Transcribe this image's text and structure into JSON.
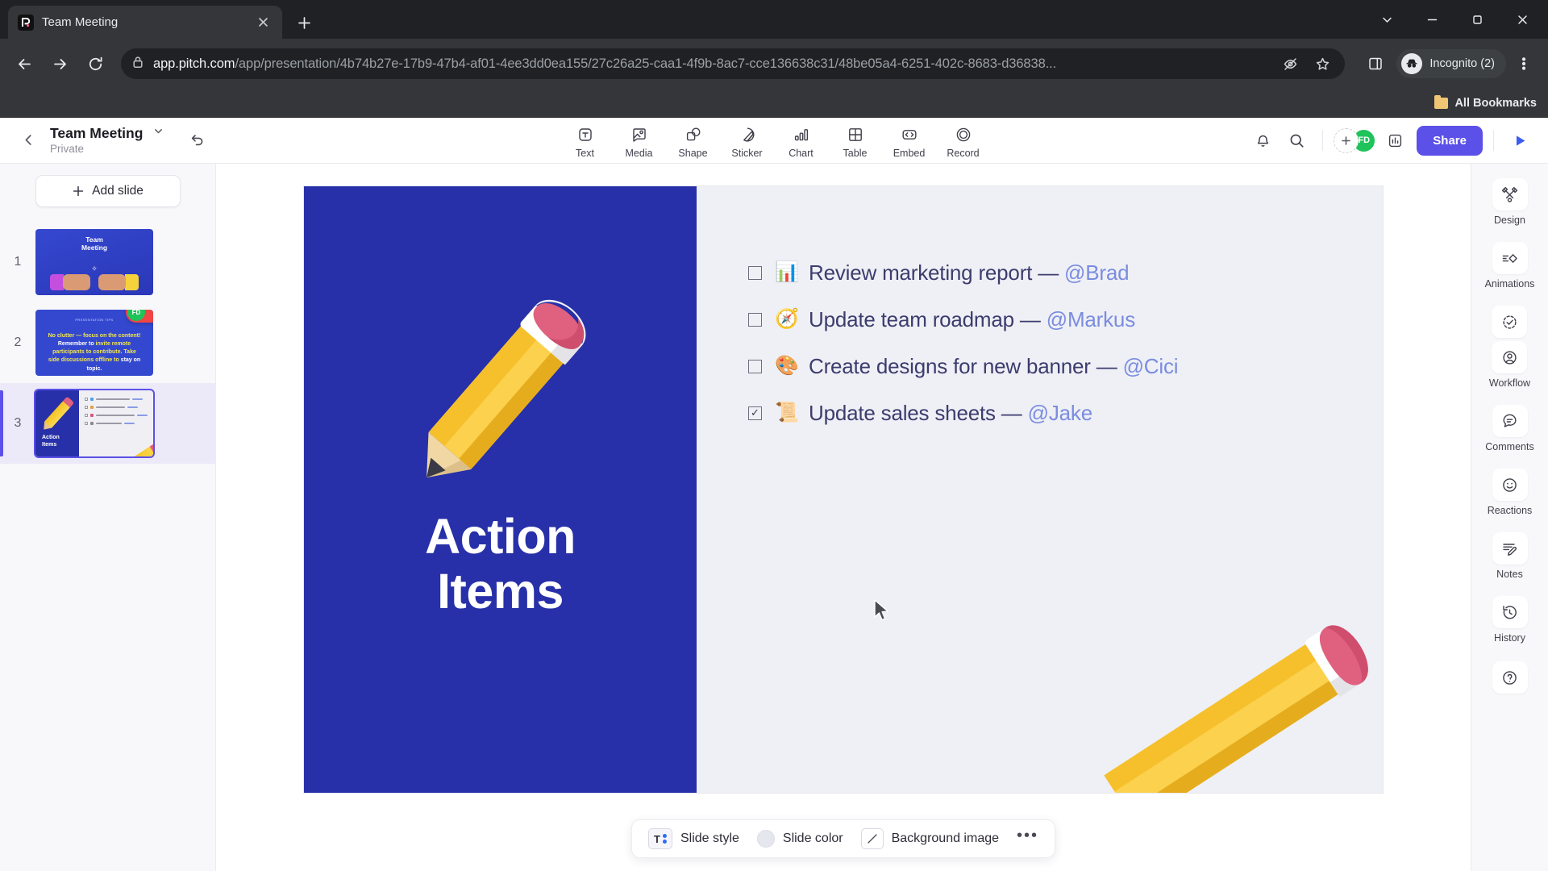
{
  "browser": {
    "tab": {
      "title": "Team Meeting",
      "favicon": "pitch-logo-icon"
    },
    "new_tab_label": "+",
    "url": {
      "host": "app.pitch.com",
      "path": "/app/presentation/4b74b27e-17b9-47b4-af01-4ee3dd0ea155/27c26a25-caa1-4f9b-8ac7-cce136638c31/48be05a4-6251-402c-8683-d36838..."
    },
    "profile_label": "Incognito (2)",
    "bookmarks_label": "All Bookmarks"
  },
  "app_header": {
    "deck_title": "Team Meeting",
    "deck_visibility": "Private",
    "tools": [
      {
        "label": "Text",
        "icon": "text-icon"
      },
      {
        "label": "Media",
        "icon": "media-icon"
      },
      {
        "label": "Shape",
        "icon": "shape-icon"
      },
      {
        "label": "Sticker",
        "icon": "sticker-icon"
      },
      {
        "label": "Chart",
        "icon": "chart-icon"
      },
      {
        "label": "Table",
        "icon": "table-icon"
      },
      {
        "label": "Embed",
        "icon": "embed-icon"
      },
      {
        "label": "Record",
        "icon": "record-icon"
      }
    ],
    "avatar_initials": "FD",
    "share_label": "Share",
    "accent_color": "#5b50e8",
    "avatar_color": "#1ec35a"
  },
  "slide_panel": {
    "add_slide_label": "Add slide",
    "slides": [
      {
        "number": "1",
        "title": "Team Meeting",
        "selected": false
      },
      {
        "number": "2",
        "title": "No clutter — focus on the content!",
        "selected": false,
        "badge_initials": "FD"
      },
      {
        "number": "3",
        "title": "Action Items",
        "selected": true
      }
    ]
  },
  "slide": {
    "title_line1": "Action",
    "title_line2": "Items",
    "background_color": "#2730a8",
    "panel_color": "#eef0f5",
    "tasks": [
      {
        "checked": false,
        "emoji": "📊",
        "emoji_name": "bar-chart-emoji",
        "text": "Review marketing report — ",
        "assignee": "@Brad"
      },
      {
        "checked": false,
        "emoji": "🧭",
        "emoji_name": "compass-emoji",
        "text": "Update team roadmap — ",
        "assignee": "@Markus"
      },
      {
        "checked": false,
        "emoji": "🎨",
        "emoji_name": "palette-emoji",
        "text": "Create designs for new banner — ",
        "assignee": "@Cici"
      },
      {
        "checked": true,
        "emoji": "📜",
        "emoji_name": "scroll-emoji",
        "text": "Update sales sheets — ",
        "assignee": "@Jake"
      }
    ]
  },
  "slide_toolbar": {
    "slide_style_label": "Slide style",
    "slide_color_label": "Slide color",
    "background_image_label": "Background image",
    "more_label": "•••",
    "style_glyph": "T"
  },
  "right_rail": [
    {
      "label": "Design",
      "icon": "design-icon"
    },
    {
      "label": "Animations",
      "icon": "animations-icon"
    },
    {
      "label": "Workflow",
      "icon": "workflow-icon"
    },
    {
      "label": "Comments",
      "icon": "comments-icon"
    },
    {
      "label": "Reactions",
      "icon": "reactions-icon"
    },
    {
      "label": "Notes",
      "icon": "notes-icon"
    },
    {
      "label": "History",
      "icon": "history-icon"
    }
  ]
}
